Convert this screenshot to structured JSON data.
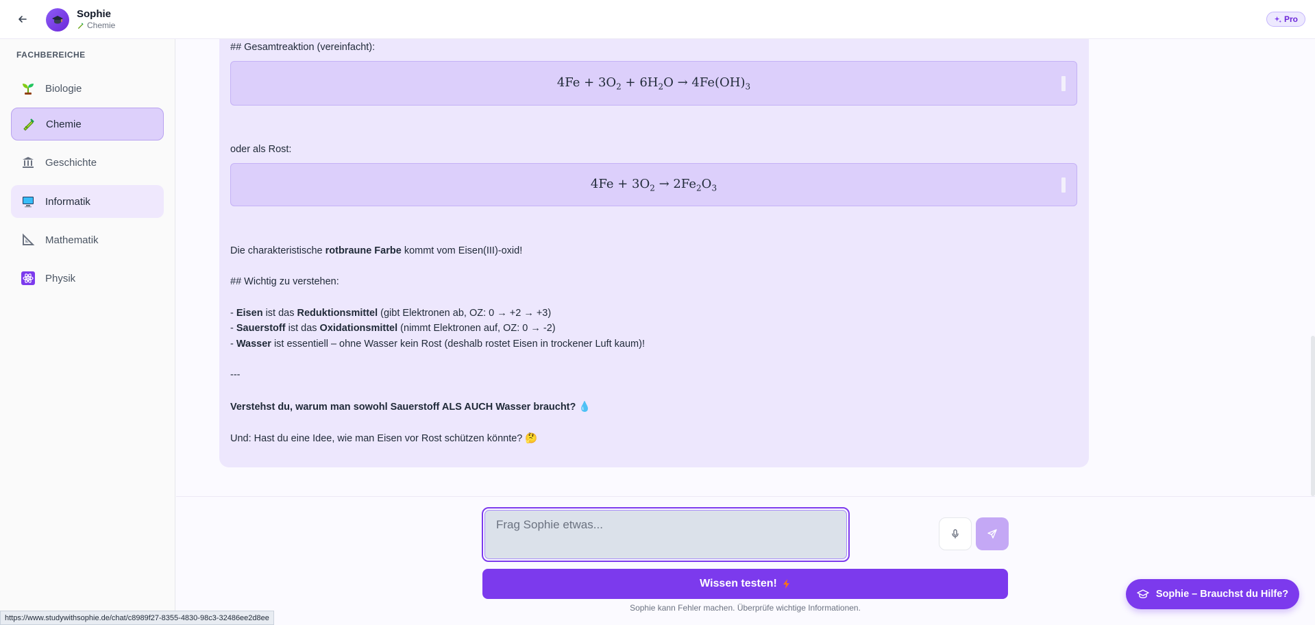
{
  "header": {
    "name": "Sophie",
    "subject": "Chemie",
    "pro_label": "Pro"
  },
  "sidebar": {
    "title": "FACHBEREICHE",
    "items": [
      {
        "label": "Biologie",
        "icon": "seedling-icon"
      },
      {
        "label": "Chemie",
        "icon": "test-tube-icon"
      },
      {
        "label": "Geschichte",
        "icon": "classical-building-icon"
      },
      {
        "label": "Informatik",
        "icon": "computer-icon"
      },
      {
        "label": "Mathematik",
        "icon": "triangular-ruler-icon"
      },
      {
        "label": "Physik",
        "icon": "atom-icon"
      }
    ]
  },
  "message": {
    "heading1": "## Gesamtreaktion (vereinfacht):",
    "or_rust": "oder als Rost:",
    "color_pre": "Die charakteristische ",
    "color_bold": "rotbraune Farbe",
    "color_post": " kommt vom Eisen(III)-oxid!",
    "heading2": "## Wichtig zu verstehen:",
    "b1_dash": "- ",
    "b1_bold1": "Eisen",
    "b1_mid": " ist das ",
    "b1_bold2": "Reduktionsmittel",
    "b1_post": " (gibt Elektronen ab, OZ: 0 → +2 → +3)",
    "b2_dash": "- ",
    "b2_bold1": "Sauerstoff",
    "b2_mid": " ist das ",
    "b2_bold2": "Oxidationsmittel",
    "b2_post": " (nimmt Elektronen auf, OZ: 0 → -2)",
    "b3_dash": "- ",
    "b3_bold1": "Wasser",
    "b3_post": " ist essentiell – ohne Wasser kein Rost (deshalb rostet Eisen in trockener Luft kaum)!",
    "separator": "---",
    "question": "Verstehst du, warum man sowohl Sauerstoff ALS AUCH Wasser braucht? 💧",
    "followup": "Und: Hast du eine Idee, wie man Eisen vor Rost schützen könnte? 🤔"
  },
  "input": {
    "placeholder": "Frag Sophie etwas..."
  },
  "quiz_button": "Wissen testen!",
  "disclaimer": "Sophie kann Fehler machen. Überprüfe wichtige Informationen.",
  "help_button": "Sophie – Brauchst du Hilfe?",
  "status_url": "https://www.studywithsophie.de/chat/c8989f27-8355-4830-98c3-32486ee2d8ee",
  "colors": {
    "accent": "#7c3aed",
    "message_bg": "#ede7fd",
    "math_bg": "#dccffb",
    "active_item_bg": "#ddd0fb"
  }
}
